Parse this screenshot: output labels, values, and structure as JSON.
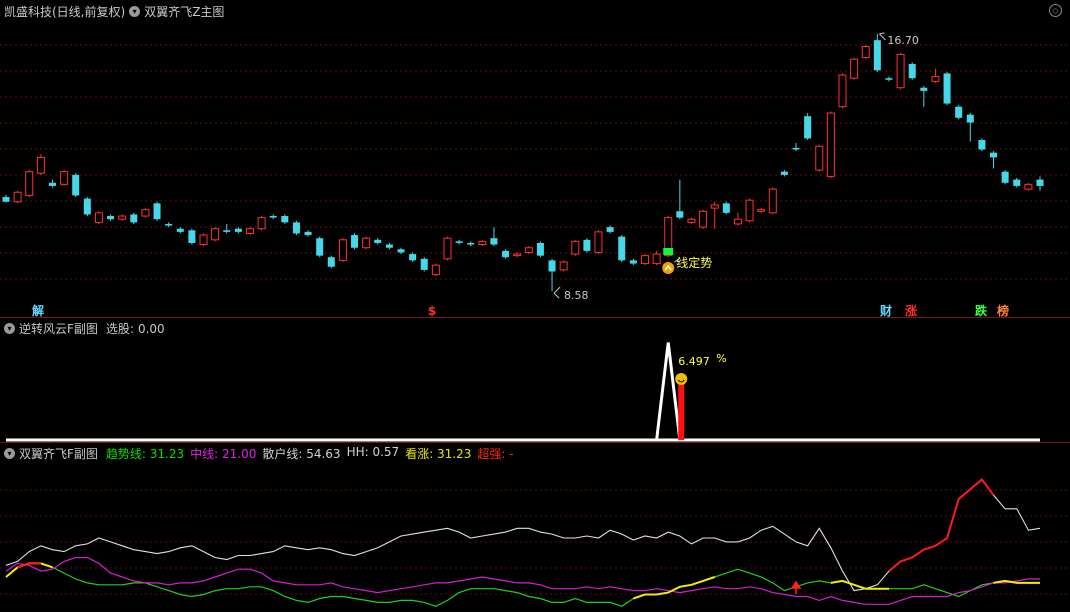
{
  "main": {
    "title": "凯盛科技(日线,前复权)",
    "indicator_name": "双翼齐飞Z主图",
    "high_label": "16.70",
    "low_label": "8.58",
    "trend_label": "线定势",
    "markers": [
      "解",
      "$",
      "财",
      "涨",
      "跌",
      "榜"
    ]
  },
  "sub1": {
    "title": "逆转风云F副图",
    "field_label": "选股:",
    "field_value": "0.00",
    "peak_label": "6.497",
    "pct_label": "%"
  },
  "sub2": {
    "title": "双翼齐飞F副图",
    "items": [
      {
        "label": "趋势线:",
        "value": "31.23",
        "color": "#00e000"
      },
      {
        "label": "中线:",
        "value": "21.00",
        "color": "#e020e0"
      },
      {
        "label": "散户线:",
        "value": "54.63",
        "color": "#d0d0d0"
      },
      {
        "label": "HH:",
        "value": "0.57",
        "color": "#d0d0d0"
      },
      {
        "label": "看涨:",
        "value": "31.23",
        "color": "#e8e800"
      },
      {
        "label": "超强:",
        "value": "-",
        "color": "#ff2020"
      }
    ]
  },
  "chart_data": {
    "type": "candlestick",
    "price_axis_printed": false,
    "candles": [
      [
        11.55,
        11.4,
        11.62,
        11.38
      ],
      [
        11.4,
        11.7,
        11.75,
        11.35
      ],
      [
        11.6,
        12.35,
        12.4,
        11.55
      ],
      [
        12.3,
        12.8,
        12.9,
        12.25
      ],
      [
        12.0,
        11.9,
        12.1,
        11.85
      ],
      [
        11.95,
        12.35,
        12.4,
        11.9
      ],
      [
        12.25,
        11.6,
        12.3,
        11.55
      ],
      [
        11.5,
        11.0,
        11.55,
        10.95
      ],
      [
        10.75,
        11.05,
        11.1,
        10.7
      ],
      [
        10.95,
        10.85,
        11.0,
        10.8
      ],
      [
        10.85,
        10.95,
        11.0,
        10.8
      ],
      [
        11.0,
        10.75,
        11.05,
        10.7
      ],
      [
        10.95,
        11.15,
        11.2,
        10.9
      ],
      [
        11.35,
        10.85,
        11.4,
        10.8
      ],
      [
        10.7,
        10.65,
        10.75,
        10.6
      ],
      [
        10.55,
        10.45,
        10.6,
        10.4
      ],
      [
        10.5,
        10.1,
        10.55,
        10.05
      ],
      [
        10.05,
        10.35,
        10.4,
        10.0
      ],
      [
        10.2,
        10.55,
        10.6,
        10.15
      ],
      [
        10.5,
        10.45,
        10.7,
        10.4
      ],
      [
        10.55,
        10.45,
        10.6,
        10.4
      ],
      [
        10.4,
        10.55,
        10.6,
        10.35
      ],
      [
        10.55,
        10.9,
        10.95,
        10.5
      ],
      [
        10.95,
        10.9,
        11.0,
        10.85
      ],
      [
        10.95,
        10.75,
        11.0,
        10.7
      ],
      [
        10.75,
        10.4,
        10.8,
        10.35
      ],
      [
        10.45,
        10.35,
        10.5,
        10.3
      ],
      [
        10.25,
        9.7,
        10.3,
        9.65
      ],
      [
        9.65,
        9.35,
        9.7,
        9.3
      ],
      [
        9.55,
        10.2,
        10.25,
        9.5
      ],
      [
        10.35,
        9.95,
        10.4,
        9.9
      ],
      [
        9.95,
        10.25,
        10.3,
        9.9
      ],
      [
        10.2,
        10.1,
        10.25,
        10.05
      ],
      [
        10.05,
        9.95,
        10.1,
        9.9
      ],
      [
        9.9,
        9.8,
        9.95,
        9.75
      ],
      [
        9.75,
        9.55,
        9.8,
        9.5
      ],
      [
        9.6,
        9.25,
        9.65,
        9.2
      ],
      [
        9.1,
        9.4,
        9.45,
        9.05
      ],
      [
        9.6,
        10.25,
        10.3,
        9.55
      ],
      [
        10.15,
        10.1,
        10.2,
        10.05
      ],
      [
        10.1,
        10.05,
        10.15,
        10.0
      ],
      [
        10.05,
        10.15,
        10.2,
        10.0
      ],
      [
        10.25,
        10.05,
        10.6,
        10.0
      ],
      [
        9.85,
        9.65,
        9.9,
        9.6
      ],
      [
        9.7,
        9.75,
        9.8,
        9.65
      ],
      [
        9.8,
        9.95,
        10.0,
        9.75
      ],
      [
        10.1,
        9.7,
        10.15,
        9.65
      ],
      [
        9.55,
        9.2,
        9.6,
        8.58
      ],
      [
        9.25,
        9.5,
        9.55,
        9.2
      ],
      [
        9.75,
        10.15,
        10.2,
        9.7
      ],
      [
        10.2,
        9.85,
        10.25,
        9.8
      ],
      [
        9.8,
        10.45,
        10.5,
        9.75
      ],
      [
        10.6,
        10.45,
        10.65,
        10.4
      ],
      [
        10.3,
        9.55,
        10.35,
        9.5
      ],
      [
        9.55,
        9.45,
        9.6,
        9.4
      ],
      [
        9.45,
        9.7,
        9.75,
        9.4
      ],
      [
        9.45,
        9.75,
        9.85,
        9.4
      ],
      [
        9.7,
        10.9,
        10.95,
        9.65
      ],
      [
        11.1,
        10.9,
        12.1,
        10.85
      ],
      [
        10.75,
        10.85,
        10.9,
        10.7
      ],
      [
        10.6,
        11.1,
        11.15,
        10.55
      ],
      [
        11.2,
        11.3,
        11.4,
        10.55
      ],
      [
        11.35,
        11.05,
        11.4,
        11.0
      ],
      [
        10.7,
        10.85,
        11.05,
        10.65
      ],
      [
        10.8,
        11.45,
        11.5,
        10.75
      ],
      [
        11.1,
        11.15,
        11.2,
        11.05
      ],
      [
        11.05,
        11.8,
        11.85,
        11.0
      ],
      [
        12.35,
        12.25,
        12.4,
        12.2
      ],
      [
        13.1,
        13.05,
        13.25,
        13.0
      ],
      [
        14.1,
        13.4,
        14.2,
        13.35
      ],
      [
        12.4,
        13.15,
        13.2,
        12.35
      ],
      [
        12.2,
        14.2,
        14.25,
        12.15
      ],
      [
        14.4,
        15.4,
        15.45,
        14.35
      ],
      [
        15.3,
        15.9,
        15.95,
        15.25
      ],
      [
        15.95,
        16.3,
        16.35,
        15.9
      ],
      [
        16.5,
        15.55,
        16.7,
        15.5
      ],
      [
        15.3,
        15.25,
        15.35,
        15.2
      ],
      [
        15.0,
        16.05,
        16.1,
        14.95
      ],
      [
        15.75,
        15.3,
        15.8,
        15.25
      ],
      [
        15.0,
        14.9,
        15.05,
        14.4
      ],
      [
        15.2,
        15.35,
        15.6,
        15.15
      ],
      [
        15.45,
        14.5,
        15.5,
        14.45
      ],
      [
        14.4,
        14.05,
        14.45,
        14.0
      ],
      [
        14.15,
        13.9,
        14.2,
        13.3
      ],
      [
        13.35,
        13.05,
        13.4,
        13.0
      ],
      [
        12.95,
        12.8,
        13.0,
        12.45
      ],
      [
        12.35,
        12.0,
        12.4,
        11.95
      ],
      [
        12.1,
        11.9,
        12.15,
        11.85
      ],
      [
        11.8,
        11.95,
        12.0,
        11.75
      ],
      [
        12.1,
        11.9,
        12.2,
        11.75
      ]
    ],
    "sub1_xyxs": [
      0,
      0,
      0,
      0,
      0,
      0,
      0,
      0,
      0,
      0,
      0,
      0,
      0,
      0,
      0,
      0,
      0,
      0,
      0,
      0,
      0,
      0,
      0,
      0,
      0,
      0,
      0,
      0,
      0,
      0,
      0,
      0,
      0,
      0,
      0,
      0,
      0,
      0,
      0,
      0,
      0,
      0,
      0,
      0,
      0,
      0,
      0,
      0,
      0,
      0,
      0,
      0,
      0,
      0,
      0,
      0,
      0,
      0,
      0,
      0,
      0,
      0,
      0,
      0,
      0,
      0,
      0,
      0,
      0,
      0,
      0,
      0,
      0,
      0,
      0,
      0,
      0,
      0,
      0,
      0,
      0,
      0,
      0,
      0,
      0,
      0,
      0,
      0,
      0,
      0
    ],
    "sub1_peak": {
      "index": 57,
      "value": 6.497,
      "bar_value": 3.7,
      "max": 7.0
    },
    "sub2_lines": {
      "retail": [
        54,
        52,
        47,
        44,
        46,
        47,
        44,
        43,
        40,
        42,
        44,
        46,
        47,
        48,
        47,
        45,
        44,
        47,
        50,
        51,
        49,
        49,
        48,
        47,
        44,
        45,
        46,
        45,
        46,
        48,
        49,
        47,
        45,
        42,
        39,
        38,
        37,
        36,
        35,
        37,
        40,
        39,
        38,
        37,
        35,
        35,
        37,
        38,
        40,
        40,
        39,
        40,
        36,
        38,
        41,
        39,
        40,
        37,
        39,
        43,
        40,
        40,
        42,
        42,
        40,
        36,
        34,
        38,
        42,
        44,
        35,
        45,
        57,
        67,
        66,
        64,
        57,
        52,
        50,
        46,
        44,
        40,
        20,
        15,
        10,
        18,
        25,
        25,
        36,
        35
      ],
      "middle": [
        57,
        53,
        54,
        57,
        56,
        52,
        50,
        50,
        53,
        58,
        60,
        62,
        63,
        63,
        64,
        63,
        63,
        62,
        60,
        58,
        56,
        56,
        58,
        62,
        63,
        64,
        64,
        64,
        63,
        65,
        66,
        67,
        68,
        67,
        66,
        65,
        64,
        63,
        63,
        62,
        61,
        60,
        61,
        62,
        63,
        63,
        64,
        66,
        66,
        66,
        65,
        66,
        65,
        66,
        67,
        67,
        66,
        67,
        68,
        67,
        66,
        65,
        66,
        66,
        65,
        66,
        68,
        69,
        70,
        70,
        72,
        70,
        72,
        73,
        74,
        74,
        74,
        72,
        70,
        70,
        70,
        70,
        68,
        67,
        65,
        63,
        63,
        62,
        61,
        61
      ],
      "trend": [
        60,
        55,
        53,
        53,
        55,
        58,
        61,
        63,
        64,
        64,
        64,
        63,
        63,
        65,
        67,
        69,
        70,
        69,
        67,
        66,
        66,
        65,
        65,
        67,
        70,
        72,
        73,
        71,
        70,
        70,
        71,
        72,
        73,
        73,
        72,
        72,
        73,
        75,
        72,
        68,
        66,
        66,
        66,
        67,
        68,
        70,
        71,
        73,
        73,
        71,
        73,
        73,
        73,
        75,
        71,
        69,
        69,
        68,
        65,
        64,
        62,
        60,
        58,
        56,
        58,
        60,
        63,
        67,
        65,
        63,
        62,
        63,
        62,
        64,
        66,
        66,
        66,
        66,
        66,
        64,
        66,
        68,
        70,
        67,
        64,
        63,
        62,
        63,
        63,
        63
      ],
      "bullish_segments": [
        [
          54,
          61
        ],
        [
          71,
          76
        ],
        [
          85,
          89
        ]
      ],
      "strong_segment": [
        76,
        85
      ]
    }
  }
}
